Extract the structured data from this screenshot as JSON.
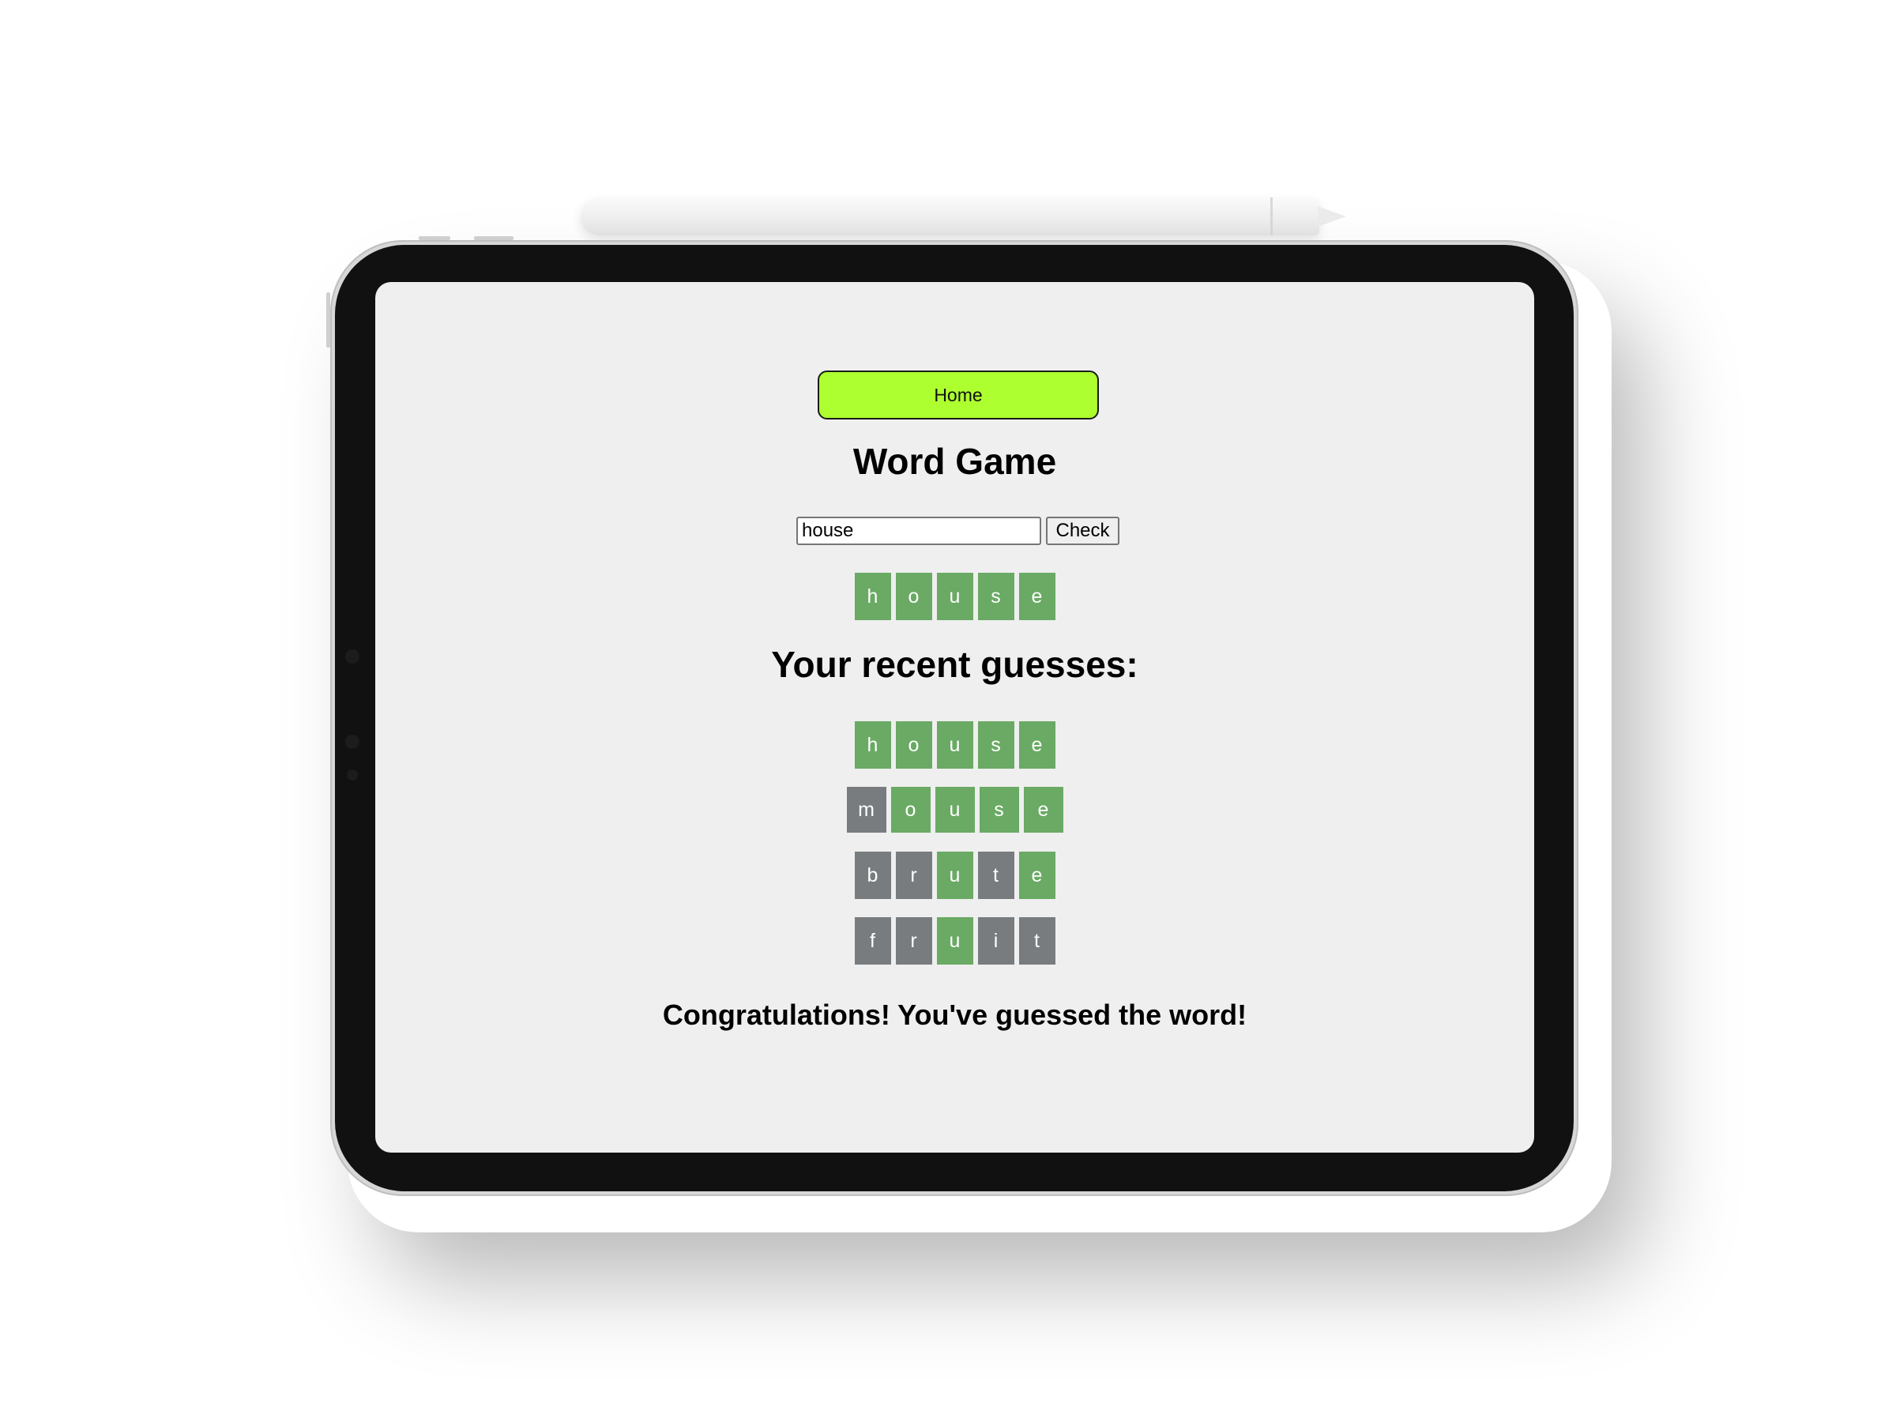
{
  "app": {
    "home_label": "Home",
    "title": "Word Game"
  },
  "input": {
    "value": "house",
    "check_label": "Check"
  },
  "current_guess": [
    "h",
    "o",
    "u",
    "s",
    "e"
  ],
  "recent_title": "Your recent guesses:",
  "recent_guesses": [
    {
      "letters": [
        "h",
        "o",
        "u",
        "s",
        "e"
      ],
      "states": [
        "correct",
        "correct",
        "correct",
        "correct",
        "correct"
      ]
    },
    {
      "letters": [
        "m",
        "o",
        "u",
        "s",
        "e"
      ],
      "states": [
        "absent",
        "correct",
        "correct",
        "correct",
        "correct"
      ]
    },
    {
      "letters": [
        "b",
        "r",
        "u",
        "t",
        "e"
      ],
      "states": [
        "absent",
        "absent",
        "correct",
        "absent",
        "correct"
      ]
    },
    {
      "letters": [
        "f",
        "r",
        "u",
        "i",
        "t"
      ],
      "states": [
        "absent",
        "absent",
        "correct",
        "absent",
        "absent"
      ]
    }
  ],
  "message": "Congratulations! You've guessed the word!",
  "colors": {
    "correct": "#6aaa64",
    "absent": "#787c7e",
    "home_button": "#adff2f",
    "screen_background": "#efefef"
  }
}
